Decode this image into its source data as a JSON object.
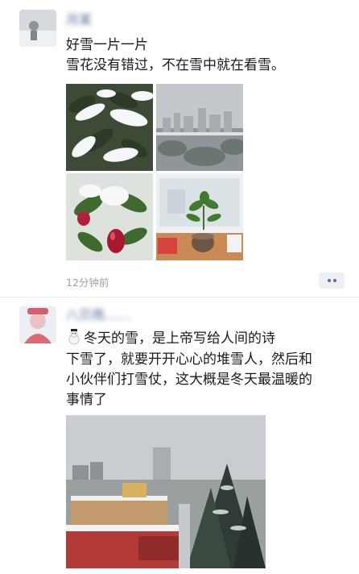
{
  "posts": [
    {
      "name": "月某",
      "lines": [
        "好雪一片一片",
        "雪花没有错过，不在雪中就在看雪。"
      ],
      "time": "12分钟前",
      "images": [
        "snow-covered-leaves",
        "snowy-city-view",
        "red-fruit-with-snow",
        "potted-plant-on-desk"
      ]
    },
    {
      "name": "八贝雨……",
      "lines": [
        "冬天的雪，是上帝写给人间的诗",
        "下雪了，就要开开心心的堆雪人，然后和",
        "小伙伴们打雪仗，这大概是冬天最温暖的",
        "事情了"
      ],
      "emoji": "snowman-icon",
      "images": [
        "snowy-campus-view"
      ]
    }
  ],
  "colors": {
    "name_blue": "#576b95",
    "time_gray": "#a0a0a0",
    "more_bg": "#eef0f4"
  }
}
